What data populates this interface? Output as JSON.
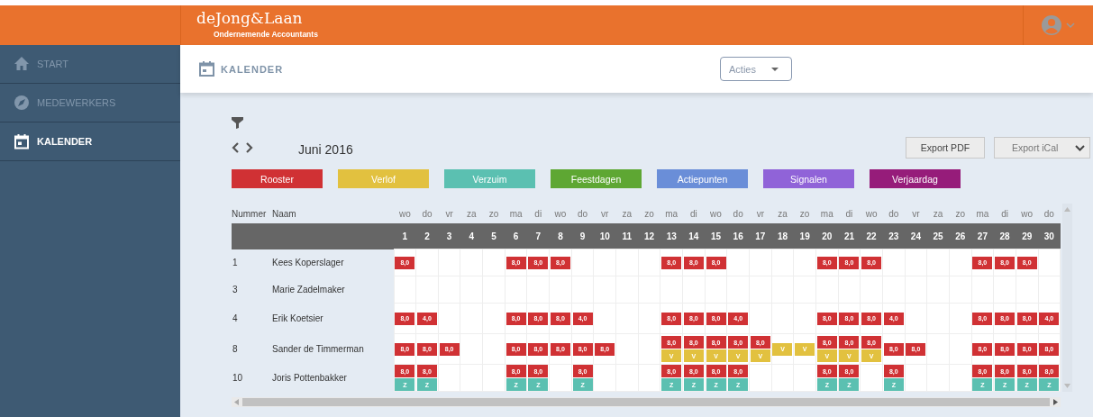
{
  "header": {
    "logo": "deJong&Laan",
    "tagline": "Ondernemende Accountants"
  },
  "sidebar": {
    "items": [
      {
        "label": "START",
        "kind": "home",
        "selected": false
      },
      {
        "label": "MEDEWERKERS",
        "kind": "compass",
        "selected": false
      },
      {
        "label": "KALENDER",
        "kind": "calendar",
        "selected": true
      }
    ]
  },
  "page": {
    "title": "KALENDER",
    "actions": "Acties"
  },
  "toolbar": {
    "month": "Juni 2016",
    "buttons": [
      {
        "label": "Export PDF",
        "kind": "plain"
      },
      {
        "label": "Export iCal",
        "kind": "dropdown"
      }
    ]
  },
  "legend": [
    {
      "label": "Rooster",
      "kind": "rooster",
      "color": "#d03134"
    },
    {
      "label": "Verlof",
      "kind": "verlof",
      "color": "#e2c13f"
    },
    {
      "label": "Verzuim",
      "kind": "verzuim",
      "color": "#5bc0b1"
    },
    {
      "label": "Feestdagen",
      "kind": "feestdagen",
      "color": "#5ea733"
    },
    {
      "label": "Actiepunten",
      "kind": "actiepunten",
      "color": "#6a8ed8"
    },
    {
      "label": "Signalen",
      "kind": "signalen",
      "color": "#9063d8"
    },
    {
      "label": "Verjaardag",
      "kind": "verjaardag",
      "color": "#961c7a"
    }
  ],
  "table": {
    "columns": [
      "Nummer",
      "Naam"
    ],
    "weekdays": [
      "wo",
      "do",
      "vr",
      "za",
      "zo",
      "ma",
      "di",
      "wo",
      "do",
      "vr",
      "za",
      "zo",
      "ma",
      "di",
      "wo",
      "do",
      "vr",
      "za",
      "zo",
      "ma",
      "di",
      "wo",
      "do",
      "vr",
      "za",
      "zo",
      "ma",
      "di",
      "wo",
      "do"
    ],
    "days": [
      "1",
      "2",
      "3",
      "4",
      "5",
      "6",
      "7",
      "8",
      "9",
      "10",
      "11",
      "12",
      "13",
      "14",
      "15",
      "16",
      "17",
      "18",
      "19",
      "20",
      "21",
      "22",
      "23",
      "24",
      "25",
      "26",
      "27",
      "28",
      "29",
      "30"
    ],
    "rows": [
      {
        "number": "1",
        "name": "Kees Koperslager",
        "cells": [
          {
            "entries": [
              {
                "kind": "rooster",
                "text": "8,0"
              }
            ]
          },
          {},
          {},
          {},
          {},
          {
            "entries": [
              {
                "kind": "rooster",
                "text": "8,0"
              }
            ]
          },
          {
            "entries": [
              {
                "kind": "rooster",
                "text": "8,0"
              }
            ]
          },
          {
            "entries": [
              {
                "kind": "rooster",
                "text": "8,0"
              }
            ]
          },
          {},
          {},
          {},
          {},
          {
            "entries": [
              {
                "kind": "rooster",
                "text": "8,0"
              }
            ]
          },
          {
            "entries": [
              {
                "kind": "rooster",
                "text": "8,0"
              }
            ]
          },
          {
            "entries": [
              {
                "kind": "rooster",
                "text": "8,0"
              }
            ]
          },
          {},
          {},
          {},
          {},
          {
            "entries": [
              {
                "kind": "rooster",
                "text": "8,0"
              }
            ]
          },
          {
            "entries": [
              {
                "kind": "rooster",
                "text": "8,0"
              }
            ]
          },
          {
            "entries": [
              {
                "kind": "rooster",
                "text": "8,0"
              }
            ]
          },
          {},
          {},
          {},
          {},
          {
            "entries": [
              {
                "kind": "rooster",
                "text": "8,0"
              }
            ]
          },
          {
            "entries": [
              {
                "kind": "rooster",
                "text": "8,0"
              }
            ]
          },
          {
            "entries": [
              {
                "kind": "rooster",
                "text": "8,0"
              }
            ]
          },
          {}
        ]
      },
      {
        "number": "3",
        "name": "Marie Zadelmaker",
        "cells": [
          {},
          {},
          {},
          {},
          {},
          {},
          {},
          {},
          {},
          {},
          {},
          {},
          {},
          {},
          {},
          {},
          {},
          {},
          {},
          {},
          {},
          {},
          {},
          {},
          {},
          {},
          {},
          {},
          {},
          {}
        ]
      },
      {
        "number": "4",
        "name": "Erik Koetsier",
        "cells": [
          {
            "entries": [
              {
                "kind": "rooster",
                "text": "8,0"
              }
            ]
          },
          {
            "entries": [
              {
                "kind": "rooster",
                "text": "4,0"
              }
            ]
          },
          {},
          {},
          {},
          {
            "entries": [
              {
                "kind": "rooster",
                "text": "8,0"
              }
            ]
          },
          {
            "entries": [
              {
                "kind": "rooster",
                "text": "8,0"
              }
            ]
          },
          {
            "entries": [
              {
                "kind": "rooster",
                "text": "8,0"
              }
            ]
          },
          {
            "entries": [
              {
                "kind": "rooster",
                "text": "4,0"
              }
            ]
          },
          {},
          {},
          {},
          {
            "entries": [
              {
                "kind": "rooster",
                "text": "8,0"
              }
            ]
          },
          {
            "entries": [
              {
                "kind": "rooster",
                "text": "8,0"
              }
            ]
          },
          {
            "entries": [
              {
                "kind": "rooster",
                "text": "8,0"
              }
            ]
          },
          {
            "entries": [
              {
                "kind": "rooster",
                "text": "4,0"
              }
            ]
          },
          {},
          {},
          {},
          {
            "entries": [
              {
                "kind": "rooster",
                "text": "8,0"
              }
            ]
          },
          {
            "entries": [
              {
                "kind": "rooster",
                "text": "8,0"
              }
            ]
          },
          {
            "entries": [
              {
                "kind": "rooster",
                "text": "8,0"
              }
            ]
          },
          {
            "entries": [
              {
                "kind": "rooster",
                "text": "4,0"
              }
            ]
          },
          {},
          {},
          {},
          {
            "entries": [
              {
                "kind": "rooster",
                "text": "8,0"
              }
            ]
          },
          {
            "entries": [
              {
                "kind": "rooster",
                "text": "8,0"
              }
            ]
          },
          {
            "entries": [
              {
                "kind": "rooster",
                "text": "8,0"
              }
            ]
          },
          {
            "entries": [
              {
                "kind": "rooster",
                "text": "4,0"
              }
            ]
          }
        ]
      },
      {
        "number": "8",
        "name": "Sander de Timmerman",
        "cells": [
          {
            "entries": [
              {
                "kind": "rooster",
                "text": "8,0"
              }
            ]
          },
          {
            "entries": [
              {
                "kind": "rooster",
                "text": "8,0"
              }
            ]
          },
          {
            "entries": [
              {
                "kind": "rooster",
                "text": "8,0"
              }
            ]
          },
          {},
          {},
          {
            "entries": [
              {
                "kind": "rooster",
                "text": "8,0"
              }
            ]
          },
          {
            "entries": [
              {
                "kind": "rooster",
                "text": "8,0"
              }
            ]
          },
          {
            "entries": [
              {
                "kind": "rooster",
                "text": "8,0"
              }
            ]
          },
          {
            "entries": [
              {
                "kind": "rooster",
                "text": "8,0"
              }
            ]
          },
          {
            "entries": [
              {
                "kind": "rooster",
                "text": "8,0"
              }
            ]
          },
          {},
          {},
          {
            "entries": [
              {
                "kind": "rooster",
                "text": "8,0"
              },
              {
                "kind": "verlof",
                "text": "V"
              }
            ]
          },
          {
            "entries": [
              {
                "kind": "rooster",
                "text": "8,0"
              },
              {
                "kind": "verlof",
                "text": "V"
              }
            ]
          },
          {
            "entries": [
              {
                "kind": "rooster",
                "text": "8,0"
              },
              {
                "kind": "verlof",
                "text": "V"
              }
            ]
          },
          {
            "entries": [
              {
                "kind": "rooster",
                "text": "8,0"
              },
              {
                "kind": "verlof",
                "text": "V"
              }
            ]
          },
          {
            "entries": [
              {
                "kind": "rooster",
                "text": "8,0"
              },
              {
                "kind": "verlof",
                "text": "V"
              }
            ]
          },
          {
            "entries": [
              {
                "kind": "verlof",
                "text": "V"
              }
            ]
          },
          {
            "entries": [
              {
                "kind": "verlof",
                "text": "V"
              }
            ]
          },
          {
            "entries": [
              {
                "kind": "rooster",
                "text": "8,0"
              },
              {
                "kind": "verlof",
                "text": "V"
              }
            ]
          },
          {
            "entries": [
              {
                "kind": "rooster",
                "text": "8,0"
              },
              {
                "kind": "verlof",
                "text": "V"
              }
            ]
          },
          {
            "entries": [
              {
                "kind": "rooster",
                "text": "8,0"
              },
              {
                "kind": "verlof",
                "text": "V"
              }
            ]
          },
          {
            "entries": [
              {
                "kind": "rooster",
                "text": "8,0"
              }
            ]
          },
          {
            "entries": [
              {
                "kind": "rooster",
                "text": "8,0"
              }
            ]
          },
          {},
          {},
          {
            "entries": [
              {
                "kind": "rooster",
                "text": "8,0"
              }
            ]
          },
          {
            "entries": [
              {
                "kind": "rooster",
                "text": "8,0"
              }
            ]
          },
          {
            "entries": [
              {
                "kind": "rooster",
                "text": "8,0"
              }
            ]
          },
          {
            "entries": [
              {
                "kind": "rooster",
                "text": "8,0"
              }
            ]
          }
        ]
      },
      {
        "number": "10",
        "name": "Joris Pottenbakker",
        "cells": [
          {
            "entries": [
              {
                "kind": "rooster",
                "text": "8,0"
              },
              {
                "kind": "verzuim",
                "text": "Z"
              }
            ]
          },
          {
            "entries": [
              {
                "kind": "rooster",
                "text": "8,0"
              },
              {
                "kind": "verzuim",
                "text": "Z"
              }
            ]
          },
          {},
          {},
          {},
          {
            "entries": [
              {
                "kind": "rooster",
                "text": "8,0"
              },
              {
                "kind": "verzuim",
                "text": "Z"
              }
            ]
          },
          {
            "entries": [
              {
                "kind": "rooster",
                "text": "8,0"
              },
              {
                "kind": "verzuim",
                "text": "Z"
              }
            ]
          },
          {},
          {
            "entries": [
              {
                "kind": "rooster",
                "text": "8,0"
              },
              {
                "kind": "verzuim",
                "text": "Z"
              }
            ]
          },
          {},
          {},
          {},
          {
            "entries": [
              {
                "kind": "rooster",
                "text": "8,0"
              },
              {
                "kind": "verzuim",
                "text": "Z"
              }
            ]
          },
          {
            "entries": [
              {
                "kind": "rooster",
                "text": "8,0"
              },
              {
                "kind": "verzuim",
                "text": "Z"
              }
            ]
          },
          {
            "entries": [
              {
                "kind": "rooster",
                "text": "8,0"
              },
              {
                "kind": "verzuim",
                "text": "Z"
              }
            ]
          },
          {
            "entries": [
              {
                "kind": "rooster",
                "text": "8,0"
              },
              {
                "kind": "verzuim",
                "text": "Z"
              }
            ]
          },
          {},
          {},
          {},
          {
            "entries": [
              {
                "kind": "rooster",
                "text": "8,0"
              },
              {
                "kind": "verzuim",
                "text": "Z"
              }
            ]
          },
          {
            "entries": [
              {
                "kind": "rooster",
                "text": "8,0"
              },
              {
                "kind": "verzuim",
                "text": "Z"
              }
            ]
          },
          {},
          {
            "entries": [
              {
                "kind": "rooster",
                "text": "8,0"
              },
              {
                "kind": "verzuim",
                "text": "Z"
              }
            ]
          },
          {},
          {},
          {},
          {
            "entries": [
              {
                "kind": "rooster",
                "text": "8,0"
              },
              {
                "kind": "verzuim",
                "text": "Z"
              }
            ]
          },
          {
            "entries": [
              {
                "kind": "rooster",
                "text": "8,0"
              },
              {
                "kind": "verzuim",
                "text": "Z"
              }
            ]
          },
          {
            "entries": [
              {
                "kind": "rooster",
                "text": "8,0"
              },
              {
                "kind": "verzuim",
                "text": "Z"
              }
            ]
          },
          {
            "entries": [
              {
                "kind": "rooster",
                "text": "8,0"
              },
              {
                "kind": "verzuim",
                "text": "Z"
              }
            ]
          }
        ]
      }
    ]
  }
}
